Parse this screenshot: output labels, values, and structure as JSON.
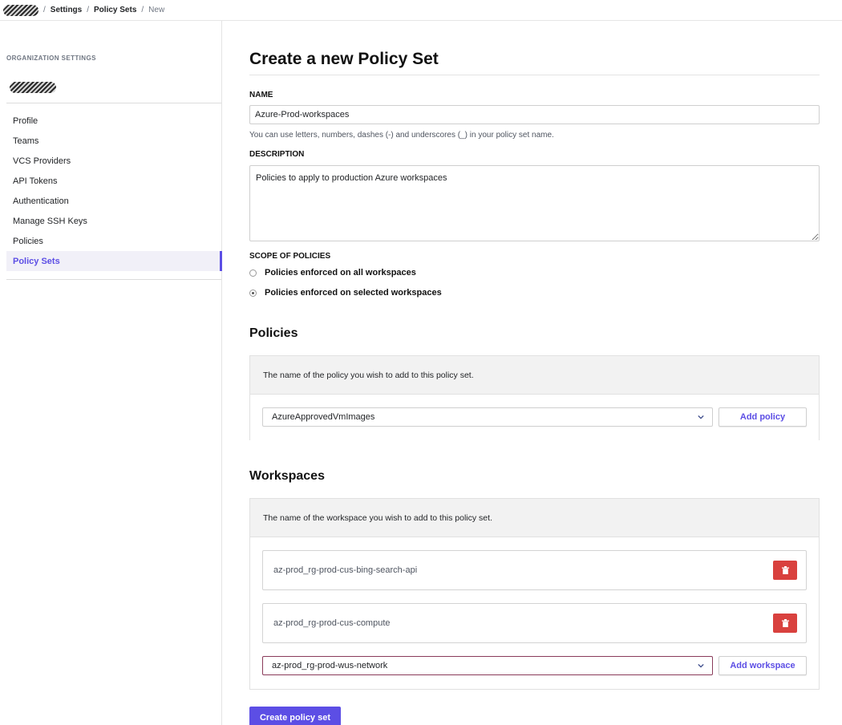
{
  "breadcrumb": {
    "items": [
      "Settings",
      "Policy Sets"
    ],
    "current": "New"
  },
  "sidebar": {
    "heading": "ORGANIZATION SETTINGS",
    "items": [
      {
        "label": "Profile"
      },
      {
        "label": "Teams"
      },
      {
        "label": "VCS Providers"
      },
      {
        "label": "API Tokens"
      },
      {
        "label": "Authentication"
      },
      {
        "label": "Manage SSH Keys"
      },
      {
        "label": "Policies"
      },
      {
        "label": "Policy Sets",
        "active": true
      }
    ]
  },
  "form": {
    "title": "Create a new Policy Set",
    "name_label": "NAME",
    "name_value": "Azure-Prod-workspaces",
    "name_hint": "You can use letters, numbers, dashes (-) and underscores (_) in your policy set name.",
    "description_label": "DESCRIPTION",
    "description_value": "Policies to apply to production Azure workspaces",
    "scope_label": "SCOPE OF POLICIES",
    "scope_options": [
      {
        "label": "Policies enforced on all workspaces",
        "selected": false
      },
      {
        "label": "Policies enforced on selected workspaces",
        "selected": true
      }
    ]
  },
  "policies": {
    "title": "Policies",
    "hint": "The name of the policy you wish to add to this policy set.",
    "selected": "AzureApprovedVmImages",
    "add_label": "Add policy"
  },
  "workspaces": {
    "title": "Workspaces",
    "hint": "The name of the workspace you wish to add to this policy set.",
    "items": [
      "az-prod_rg-prod-cus-bing-search-api",
      "az-prod_rg-prod-cus-compute"
    ],
    "selected": "az-prod_rg-prod-wus-network",
    "add_label": "Add workspace"
  },
  "submit_label": "Create policy set",
  "colors": {
    "accent": "#5c4ee5",
    "danger": "#d9413e"
  }
}
